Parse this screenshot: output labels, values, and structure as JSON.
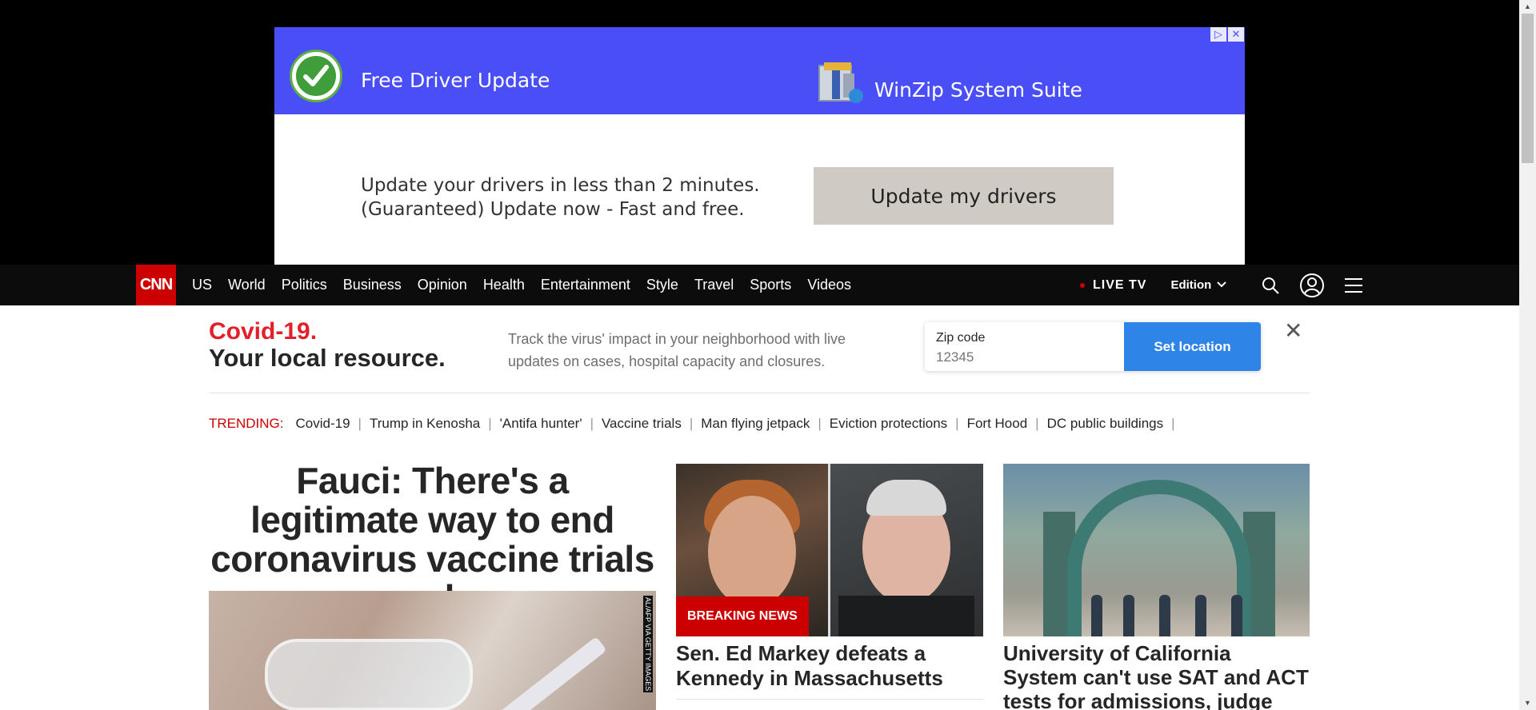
{
  "ad": {
    "left_title": "Free Driver Update",
    "right_title": "WinZip System Suite",
    "description_line1": "Update your drivers in less than 2 minutes.",
    "description_line2": "(Guaranteed) Update now - Fast and free.",
    "cta_label": "Update my drivers",
    "adchoices_icon": "adchoices-icon",
    "close_icon": "close-icon",
    "colors": {
      "banner": "#4a4ef7",
      "cta": "#cfcac4"
    }
  },
  "nav": {
    "logo_text": "CNN",
    "links": [
      "US",
      "World",
      "Politics",
      "Business",
      "Opinion",
      "Health",
      "Entertainment",
      "Style",
      "Travel",
      "Sports",
      "Videos"
    ],
    "live_tv": "LIVE TV",
    "edition": "Edition",
    "icons": [
      "search-icon",
      "account-icon",
      "menu-icon"
    ],
    "colors": {
      "background": "#0c0c0c",
      "logo": "#cc0000"
    }
  },
  "covid": {
    "title_line1": "Covid-19.",
    "title_line2": "Your local resource.",
    "description": "Track the virus' impact in your neighborhood with live updates on cases, hospital capacity and closures.",
    "zip_label": "Zip code",
    "zip_placeholder": "12345",
    "button_label": "Set location",
    "colors": {
      "accent": "#e2202a",
      "button": "#2f84e8"
    }
  },
  "trending": {
    "label": "TRENDING:",
    "items": [
      "Covid-19",
      "Trump in Kenosha",
      "'Antifa hunter'",
      "Vaccine trials",
      "Man flying jetpack",
      "Eviction protections",
      "Fort Hood",
      "DC public buildings"
    ]
  },
  "stories": {
    "lead_headline": "Fauci: There's a legitimate way to end coronavirus vaccine trials early",
    "lead_image_credit": "AL/AFP VIA GETTY IMAGES",
    "mid_badge": "BREAKING NEWS",
    "mid_headline": "Sen. Ed Markey defeats a Kennedy in Massachusetts",
    "right_headline": "University of California System can't use SAT and ACT tests for admissions, judge rules"
  }
}
